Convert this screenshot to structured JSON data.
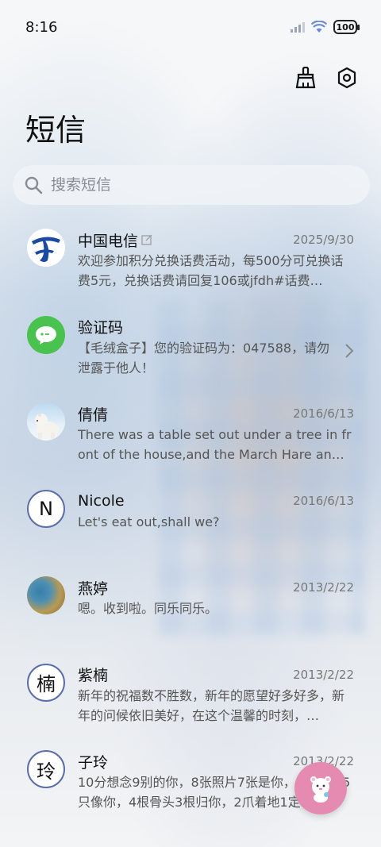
{
  "status": {
    "time": "8:16",
    "battery": "100"
  },
  "app": {
    "title": "短信"
  },
  "search": {
    "placeholder": "搜索短信"
  },
  "messages": [
    {
      "name": "中国电信",
      "date": "2025/9/30",
      "preview": "欢迎参加积分兑换话费活动，每500分可兑换话费5元，兑换话费请回复106或jfdh#话费…",
      "avatar": "china-telecom-logo"
    },
    {
      "name": "验证码",
      "date": "",
      "preview": "【毛绒盒子】您的验证码为：047588，请勿泄露于他人！",
      "avatar": "message-bubble-icon"
    },
    {
      "name": "倩倩",
      "date": "2016/6/13",
      "preview": "There was a table set out under a tree in front of the house,and the March Hare an…",
      "avatar": "polar-bear-photo"
    },
    {
      "name": "Nicole",
      "date": "2016/6/13",
      "preview": "Let's eat out,shall we?",
      "avatar": "N"
    },
    {
      "name": "燕婷",
      "date": "2013/2/22",
      "preview": "嗯。收到啦。同乐同乐。",
      "avatar": "landscape-photo"
    },
    {
      "name": "紫楠",
      "date": "2013/2/22",
      "preview": "新年的祝福数不胜数，新年的愿望好多好多，新年的问候依旧美好，在这个温馨的时刻，…",
      "avatar": "楠"
    },
    {
      "name": "子玲",
      "date": "2013/2/22",
      "preview": "10分想念9别的你，8张照片7张是你，6只小狗5只像你，4根骨头3根归你，2爪着地1定…",
      "avatar": "玲"
    }
  ],
  "colors": {
    "telecom_blue": "#1c4aa0",
    "verify_green": "#4ac24f",
    "fab_pink": "#e58bb1",
    "avatar_ring": "#5c6ea8"
  }
}
